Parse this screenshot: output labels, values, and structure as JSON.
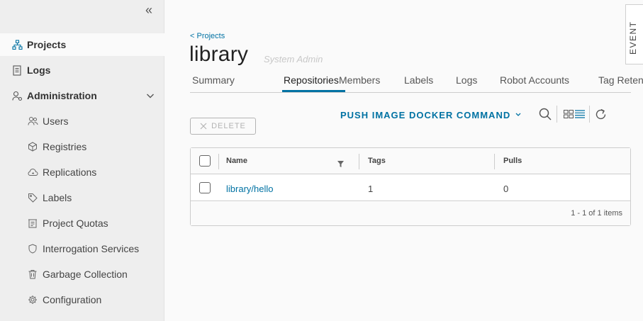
{
  "sidebar": {
    "items": [
      {
        "label": "Projects",
        "icon": "projects-icon"
      },
      {
        "label": "Logs",
        "icon": "logs-icon"
      },
      {
        "label": "Administration",
        "icon": "administration-icon"
      }
    ],
    "admin_items": [
      {
        "label": "Users",
        "icon": "users-icon"
      },
      {
        "label": "Registries",
        "icon": "registries-icon"
      },
      {
        "label": "Replications",
        "icon": "replications-icon"
      },
      {
        "label": "Labels",
        "icon": "tag-icon"
      },
      {
        "label": "Project Quotas",
        "icon": "quotas-icon"
      },
      {
        "label": "Interrogation Services",
        "icon": "shield-icon"
      },
      {
        "label": "Garbage Collection",
        "icon": "trash-icon"
      },
      {
        "label": "Configuration",
        "icon": "gear-icon"
      }
    ]
  },
  "header": {
    "breadcrumb": "< Projects",
    "title": "library",
    "role": "System Admin",
    "event_tab": "EVENT"
  },
  "tabs": [
    {
      "label": "Summary",
      "active": false
    },
    {
      "label": "Repositories",
      "active": true
    },
    {
      "label": "Members",
      "active": false
    },
    {
      "label": "Labels",
      "active": false
    },
    {
      "label": "Logs",
      "active": false
    },
    {
      "label": "Robot Accounts",
      "active": false
    },
    {
      "label": "Tag Reten",
      "active": false
    }
  ],
  "toolbar": {
    "delete_label": "DELETE",
    "push_command_label": "PUSH IMAGE DOCKER COMMAND"
  },
  "table": {
    "columns": [
      "Name",
      "Tags",
      "Pulls"
    ],
    "rows": [
      {
        "name": "library/hello",
        "tags": "1",
        "pulls": "0"
      }
    ],
    "footer": "1 - 1 of 1 items"
  },
  "colors": {
    "accent": "#0072a3",
    "sidebar_bg": "#eeeeee"
  }
}
